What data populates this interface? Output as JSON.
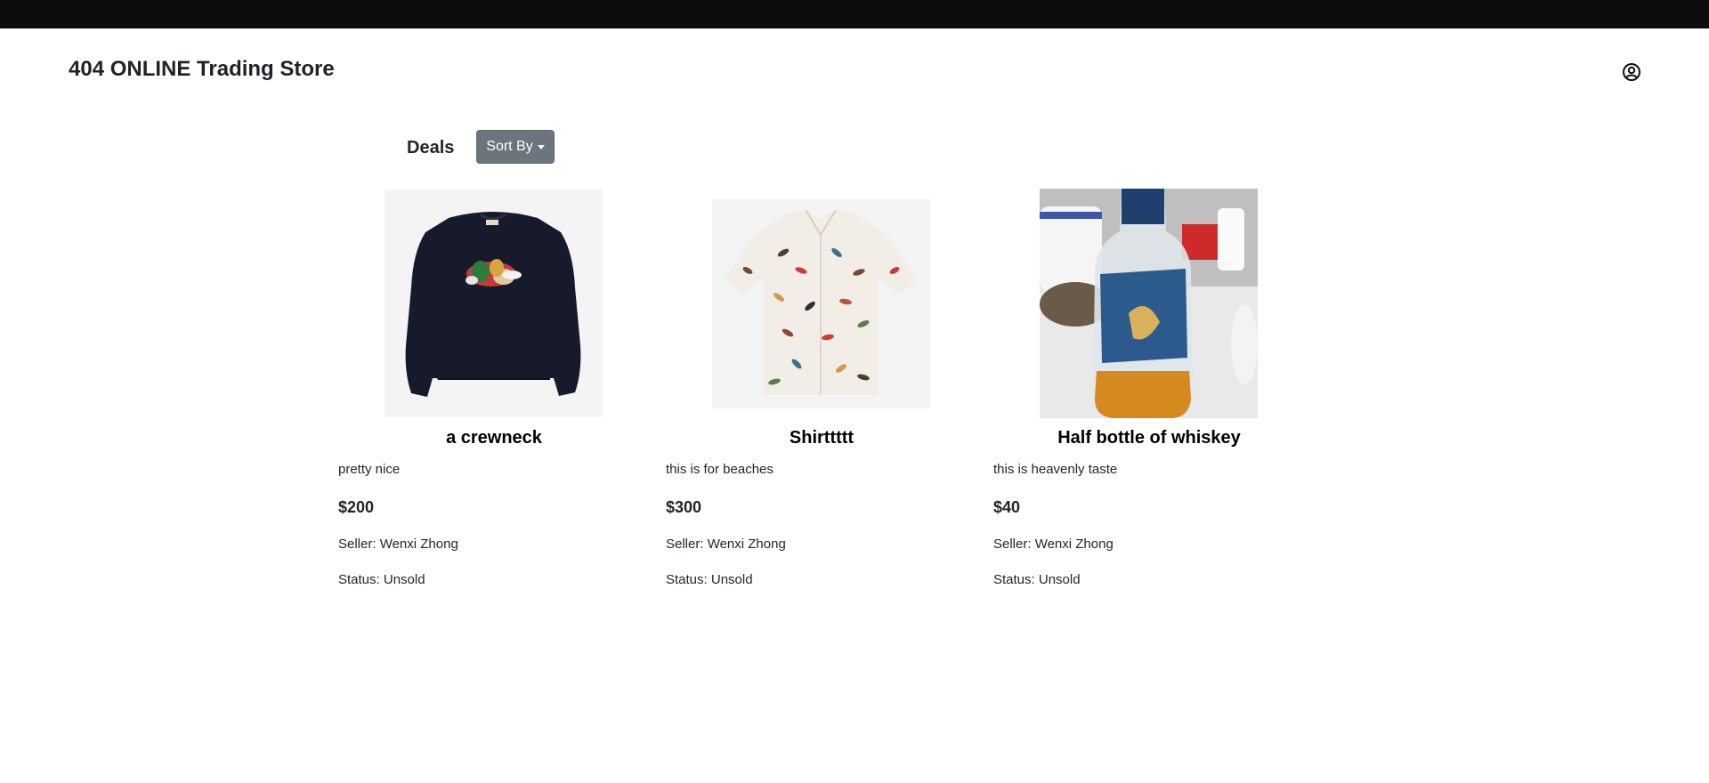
{
  "header": {
    "brand": "404 ONLINE Trading Store",
    "account_icon": "user-circle-icon"
  },
  "toolbar": {
    "deals_label": "Deals",
    "sort_label": "Sort By"
  },
  "products": [
    {
      "name": "a crewneck",
      "description": "pretty nice",
      "price": "$200",
      "seller_label": "Seller: ",
      "seller": "Wenxi Zhong",
      "status_label": "Status: ",
      "status": "Unsold",
      "image_icon": "crewneck-image"
    },
    {
      "name": "Shirttttt",
      "description": "this is for beaches",
      "price": "$300",
      "seller_label": "Seller: ",
      "seller": "Wenxi Zhong",
      "status_label": "Status: ",
      "status": "Unsold",
      "image_icon": "shirt-image"
    },
    {
      "name": "Half bottle of whiskey",
      "description": "this is heavenly taste",
      "price": "$40",
      "seller_label": "Seller: ",
      "seller": "Wenxi Zhong",
      "status_label": "Status: ",
      "status": "Unsold",
      "image_icon": "whiskey-bottle-image"
    }
  ],
  "colors": {
    "topbar": "#0d0d0d",
    "sort_button": "#6c757d"
  }
}
